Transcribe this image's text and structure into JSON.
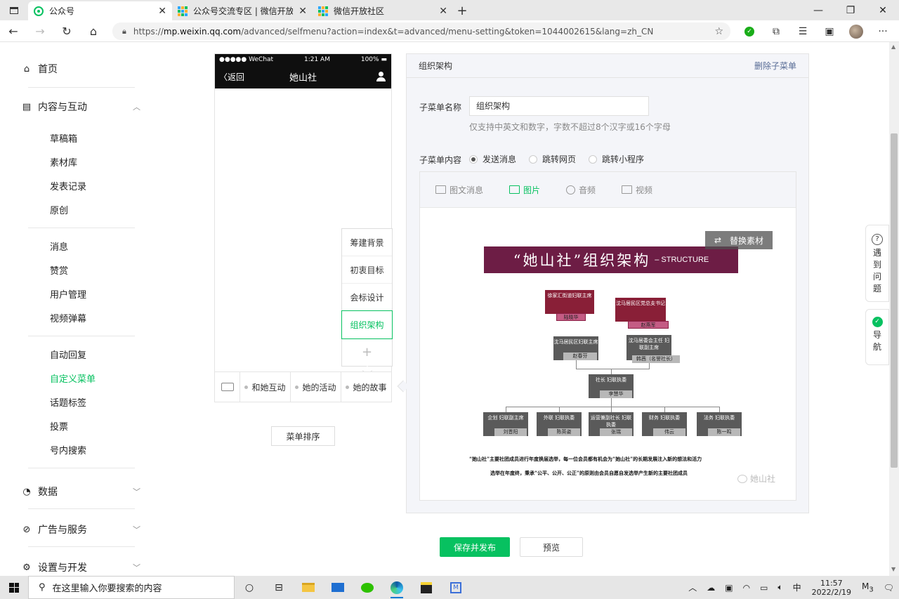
{
  "browser": {
    "tabs": [
      {
        "title": "公众号",
        "active": true
      },
      {
        "title": "公众号交流专区 | 微信开放社区",
        "active": false
      },
      {
        "title": "微信开放社区",
        "active": false
      }
    ],
    "url_prefix": "https://",
    "url_host": "mp.weixin.qq.com",
    "url_rest": "/advanced/selfmenu?action=index&t=advanced/menu-setting&token=1044002615&lang=zh_CN"
  },
  "sidebar": {
    "home": "首页",
    "content_group": "内容与互动",
    "content_items": [
      "草稿箱",
      "素材库",
      "发表记录",
      "原创"
    ],
    "msg_items": [
      "消息",
      "赞赏",
      "用户管理",
      "视频弹幕"
    ],
    "menu_items": [
      "自动回复",
      "自定义菜单",
      "话题标签",
      "投票",
      "号内搜索"
    ],
    "data_group": "数据",
    "ads_group": "广告与服务",
    "settings_group": "设置与开发"
  },
  "phone": {
    "carrier": "●●●●● WeChat",
    "time": "1:21 AM",
    "battery": "100%",
    "back": "返回",
    "account_name": "她山社",
    "submenu": [
      "筹建背景",
      "初衷目标",
      "会标设计",
      "组织架构"
    ],
    "submenu_add": "+",
    "menus": [
      "和她互动",
      "她的活动",
      "她的故事"
    ]
  },
  "sort_button": "菜单排序",
  "editor": {
    "title": "组织架构",
    "delete_link": "删除子菜单",
    "name_label": "子菜单名称",
    "name_value": "组织架构",
    "name_hint": "仅支持中英文和数字，字数不超过8个汉字或16个字母",
    "content_label": "子菜单内容",
    "content_options": [
      "发送消息",
      "跳转网页",
      "跳转小程序"
    ],
    "content_tabs": [
      "图文消息",
      "图片",
      "音频",
      "视频"
    ],
    "replace_button": "替换素材"
  },
  "poster": {
    "title_zh": "“她山社”组织架构",
    "title_en": "– STRUCTURE",
    "box_left_top": "徐家汇街道妇联主席",
    "tag_left_top": "陆晓华",
    "box_right_top": "沈马居民区党总支书记",
    "tag_right_top": "赵燕军",
    "box_mid_left": "沈马居民区妇联主席",
    "tag_mid_left": "赵春芬",
    "box_mid_right": "沈马居委会主任 妇联副主席",
    "tag_mid_right": "韩茜（名誉社长）",
    "box_center": "社长 妇联执委",
    "tag_center": "李慧华",
    "bottom_boxes": [
      {
        "role": "企划 妇联副主席",
        "name": "刘晋阳"
      },
      {
        "role": "外联 妇联执委",
        "name": "陈英姿"
      },
      {
        "role": "运营兼副社长 妇联执委",
        "name": "张瑞"
      },
      {
        "role": "财务 妇联执委",
        "name": "伟云"
      },
      {
        "role": "法务 妇联执委",
        "name": "陈一鸣"
      }
    ],
    "foot_line_1": "“她山社”主要社团成员进行年度换届选举，每一位会员都有机会为“她山社”的长期发展注入新的想法和活力",
    "foot_line_2": "选举在年度终，秉承“公平、公开、公正”的原则由会员自愿自发选举产生新的主要社团成员",
    "watermark": "她山社"
  },
  "actions": {
    "save": "保存并发布",
    "preview": "预览"
  },
  "float": {
    "help": [
      "遇",
      "到",
      "问",
      "题"
    ],
    "nav": [
      "导",
      "航"
    ]
  },
  "taskbar": {
    "search_placeholder": "在这里输入你要搜索的内容",
    "time": "11:57",
    "date": "2022/2/19",
    "ime": "中",
    "notif_count": "3"
  }
}
